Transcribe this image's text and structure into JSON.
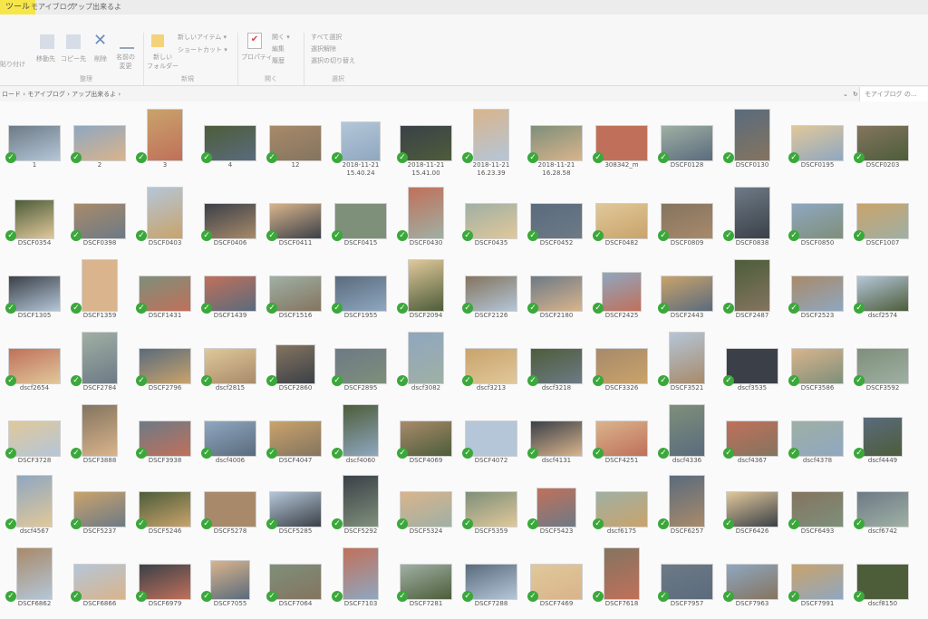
{
  "window": {
    "active_tab": "ツール",
    "title_items": [
      "モアイブログ",
      "アップ出来るよ"
    ]
  },
  "ribbon": {
    "paste_label": "貼り付け",
    "move_to": "移動先",
    "copy_to": "コピー先",
    "delete": "削除",
    "rename": "名前の\n変更",
    "new_folder": "新しい\nフォルダー",
    "new_item": "新しいアイテム ▾",
    "shortcut": "ショートカット ▾",
    "properties": "プロパティ",
    "open": "開く ▾",
    "edit": "編集",
    "history": "履歴",
    "select_all": "すべて選択",
    "select_none": "選択解除",
    "invert_selection": "選択の切り替え",
    "group_organize": "整理",
    "group_new": "新規",
    "group_open": "開く",
    "group_select": "選択"
  },
  "address": {
    "path": "ロード  ›  モアイブログ  ›  アップ出来るよ  ›",
    "search_placeholder": "モアイブログ の..."
  },
  "files": [
    {
      "name": "1"
    },
    {
      "name": "2"
    },
    {
      "name": "3"
    },
    {
      "name": "4"
    },
    {
      "name": "12"
    },
    {
      "name": "2018-11-21\n15.40.24"
    },
    {
      "name": "2018-11-21\n15.41.00"
    },
    {
      "name": "2018-11-21\n16.23.39"
    },
    {
      "name": "2018-11-21\n16.28.58"
    },
    {
      "name": "308342_m"
    },
    {
      "name": "DSCF0128"
    },
    {
      "name": "DSCF0130"
    },
    {
      "name": "DSCF0195"
    },
    {
      "name": "DSCF0203"
    },
    {
      "name": "DSCF0354"
    },
    {
      "name": "DSCF0398"
    },
    {
      "name": "DSCF0403"
    },
    {
      "name": "DSCF0406"
    },
    {
      "name": "DSCF0411"
    },
    {
      "name": "DSCF0415"
    },
    {
      "name": "DSCF0430"
    },
    {
      "name": "DSCF0435"
    },
    {
      "name": "DSCF0452"
    },
    {
      "name": "DSCF0482"
    },
    {
      "name": "DSCF0809"
    },
    {
      "name": "DSCF0838"
    },
    {
      "name": "DSCF0850"
    },
    {
      "name": "DSCF1007"
    },
    {
      "name": "DSCF1305"
    },
    {
      "name": "DSCF1359"
    },
    {
      "name": "DSCF1431"
    },
    {
      "name": "DSCF1439"
    },
    {
      "name": "DSCF1516"
    },
    {
      "name": "DSCF1955"
    },
    {
      "name": "DSCF2094"
    },
    {
      "name": "DSCF2126"
    },
    {
      "name": "DSCF2180"
    },
    {
      "name": "DSCF2425"
    },
    {
      "name": "DSCF2443"
    },
    {
      "name": "DSCF2487"
    },
    {
      "name": "DSCF2523"
    },
    {
      "name": "dscf2574"
    },
    {
      "name": "dscf2654"
    },
    {
      "name": "DSCF2784"
    },
    {
      "name": "DSCF2796"
    },
    {
      "name": "dscf2815"
    },
    {
      "name": "DSCF2860"
    },
    {
      "name": "DSCF2895"
    },
    {
      "name": "dscf3082"
    },
    {
      "name": "dscf3213"
    },
    {
      "name": "dscf3218"
    },
    {
      "name": "DSCF3326"
    },
    {
      "name": "DSCF3521"
    },
    {
      "name": "dscf3535"
    },
    {
      "name": "DSCF3586"
    },
    {
      "name": "DSCF3592"
    },
    {
      "name": "DSCF3728"
    },
    {
      "name": "DSCF3888"
    },
    {
      "name": "DSCF3938"
    },
    {
      "name": "dscf4006"
    },
    {
      "name": "DSCF4047"
    },
    {
      "name": "dscf4060"
    },
    {
      "name": "DSCF4069"
    },
    {
      "name": "DSCF4072"
    },
    {
      "name": "dscf4131"
    },
    {
      "name": "DSCF4251"
    },
    {
      "name": "dscf4336"
    },
    {
      "name": "dscf4367"
    },
    {
      "name": "dscf4378"
    },
    {
      "name": "dscf4449"
    },
    {
      "name": "dscf4567"
    },
    {
      "name": "DSCF5237"
    },
    {
      "name": "DSCF5246"
    },
    {
      "name": "DSCF5278"
    },
    {
      "name": "DSCF5285"
    },
    {
      "name": "DSCF5292"
    },
    {
      "name": "DSCF5324"
    },
    {
      "name": "DSCF5359"
    },
    {
      "name": "DSCF5423"
    },
    {
      "name": "dscf6175"
    },
    {
      "name": "DSCF6257"
    },
    {
      "name": "DSCF6426"
    },
    {
      "name": "DSCF6493"
    },
    {
      "name": "dscf6742"
    },
    {
      "name": "DSCF6862"
    },
    {
      "name": "DSCF6866"
    },
    {
      "name": "DSCF6979"
    },
    {
      "name": "DSCF7055"
    },
    {
      "name": "DSCF7064"
    },
    {
      "name": "DSCF7103"
    },
    {
      "name": "DSCF7281"
    },
    {
      "name": "DSCF7288"
    },
    {
      "name": "DSCF7469"
    },
    {
      "name": "DSCF7618"
    },
    {
      "name": "DSCF7957"
    },
    {
      "name": "DSCF7963"
    },
    {
      "name": "DSCF7991"
    },
    {
      "name": "dscf8150"
    }
  ],
  "colors": {
    "checkmark": "#3aa83a",
    "tab_highlight": "#f7e64a"
  }
}
